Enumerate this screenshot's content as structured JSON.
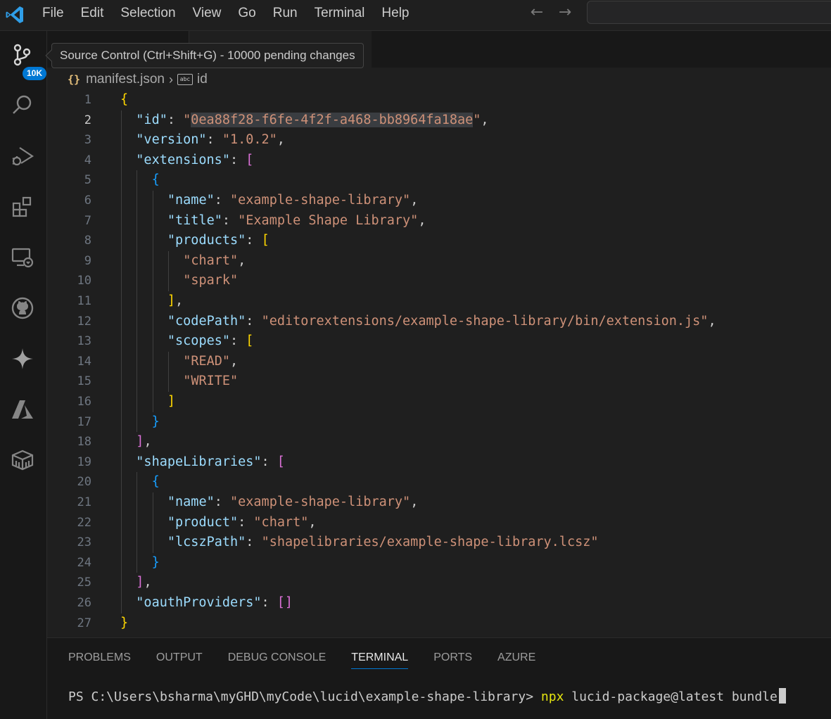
{
  "menu": [
    "File",
    "Edit",
    "Selection",
    "View",
    "Go",
    "Run",
    "Terminal",
    "Help"
  ],
  "activity_bar": {
    "items": [
      "source-control",
      "search",
      "run-debug",
      "extensions",
      "remote-explorer",
      "github",
      "copilot",
      "azure",
      "containers"
    ],
    "badge": "10K",
    "accent": "#0078d4"
  },
  "tooltip": "Source Control (Ctrl+Shift+G) - 10000 pending changes",
  "breadcrumb": {
    "file_icon": "{}",
    "file": "manifest.json",
    "symbol_icon": "abc",
    "symbol": "id"
  },
  "editor": {
    "current_line": 2,
    "lines": [
      {
        "n": "1",
        "indent": 0,
        "tokens": [
          [
            "b1",
            "{"
          ]
        ]
      },
      {
        "n": "2",
        "indent": 1,
        "tokens": [
          [
            "k",
            "\"id\""
          ],
          [
            "p",
            ": "
          ],
          [
            "s",
            "\""
          ],
          [
            "hl",
            "0ea88f28-f6fe-4f2f-a468-bb8964fa18ae"
          ],
          [
            "s",
            "\""
          ],
          [
            "p",
            ","
          ]
        ]
      },
      {
        "n": "3",
        "indent": 1,
        "tokens": [
          [
            "k",
            "\"version\""
          ],
          [
            "p",
            ": "
          ],
          [
            "s",
            "\"1.0.2\""
          ],
          [
            "p",
            ","
          ]
        ]
      },
      {
        "n": "4",
        "indent": 1,
        "tokens": [
          [
            "k",
            "\"extensions\""
          ],
          [
            "p",
            ": "
          ],
          [
            "b2",
            "["
          ]
        ]
      },
      {
        "n": "5",
        "indent": 2,
        "tokens": [
          [
            "b3",
            "{"
          ]
        ]
      },
      {
        "n": "6",
        "indent": 3,
        "tokens": [
          [
            "k",
            "\"name\""
          ],
          [
            "p",
            ": "
          ],
          [
            "s",
            "\"example-shape-library\""
          ],
          [
            "p",
            ","
          ]
        ]
      },
      {
        "n": "7",
        "indent": 3,
        "tokens": [
          [
            "k",
            "\"title\""
          ],
          [
            "p",
            ": "
          ],
          [
            "s",
            "\"Example Shape Library\""
          ],
          [
            "p",
            ","
          ]
        ]
      },
      {
        "n": "8",
        "indent": 3,
        "tokens": [
          [
            "k",
            "\"products\""
          ],
          [
            "p",
            ": "
          ],
          [
            "b1",
            "["
          ]
        ]
      },
      {
        "n": "9",
        "indent": 4,
        "tokens": [
          [
            "s",
            "\"chart\""
          ],
          [
            "p",
            ","
          ]
        ]
      },
      {
        "n": "10",
        "indent": 4,
        "tokens": [
          [
            "s",
            "\"spark\""
          ]
        ]
      },
      {
        "n": "11",
        "indent": 3,
        "tokens": [
          [
            "b1",
            "]"
          ],
          [
            "p",
            ","
          ]
        ]
      },
      {
        "n": "12",
        "indent": 3,
        "tokens": [
          [
            "k",
            "\"codePath\""
          ],
          [
            "p",
            ": "
          ],
          [
            "s",
            "\"editorextensions/example-shape-library/bin/extension.js\""
          ],
          [
            "p",
            ","
          ]
        ]
      },
      {
        "n": "13",
        "indent": 3,
        "tokens": [
          [
            "k",
            "\"scopes\""
          ],
          [
            "p",
            ": "
          ],
          [
            "b1",
            "["
          ]
        ]
      },
      {
        "n": "14",
        "indent": 4,
        "tokens": [
          [
            "s",
            "\"READ\""
          ],
          [
            "p",
            ","
          ]
        ]
      },
      {
        "n": "15",
        "indent": 4,
        "tokens": [
          [
            "s",
            "\"WRITE\""
          ]
        ]
      },
      {
        "n": "16",
        "indent": 3,
        "tokens": [
          [
            "b1",
            "]"
          ]
        ]
      },
      {
        "n": "17",
        "indent": 2,
        "tokens": [
          [
            "b3",
            "}"
          ]
        ]
      },
      {
        "n": "18",
        "indent": 1,
        "tokens": [
          [
            "b2",
            "]"
          ],
          [
            "p",
            ","
          ]
        ]
      },
      {
        "n": "19",
        "indent": 1,
        "tokens": [
          [
            "k",
            "\"shapeLibraries\""
          ],
          [
            "p",
            ": "
          ],
          [
            "b2",
            "["
          ]
        ]
      },
      {
        "n": "20",
        "indent": 2,
        "tokens": [
          [
            "b3",
            "{"
          ]
        ]
      },
      {
        "n": "21",
        "indent": 3,
        "tokens": [
          [
            "k",
            "\"name\""
          ],
          [
            "p",
            ": "
          ],
          [
            "s",
            "\"example-shape-library\""
          ],
          [
            "p",
            ","
          ]
        ]
      },
      {
        "n": "22",
        "indent": 3,
        "tokens": [
          [
            "k",
            "\"product\""
          ],
          [
            "p",
            ": "
          ],
          [
            "s",
            "\"chart\""
          ],
          [
            "p",
            ","
          ]
        ]
      },
      {
        "n": "23",
        "indent": 3,
        "tokens": [
          [
            "k",
            "\"lcszPath\""
          ],
          [
            "p",
            ": "
          ],
          [
            "s",
            "\"shapelibraries/example-shape-library.lcsz\""
          ]
        ]
      },
      {
        "n": "24",
        "indent": 2,
        "tokens": [
          [
            "b3",
            "}"
          ]
        ]
      },
      {
        "n": "25",
        "indent": 1,
        "tokens": [
          [
            "b2",
            "]"
          ],
          [
            "p",
            ","
          ]
        ]
      },
      {
        "n": "26",
        "indent": 1,
        "tokens": [
          [
            "k",
            "\"oauthProviders\""
          ],
          [
            "p",
            ": "
          ],
          [
            "b2",
            "[]"
          ]
        ]
      },
      {
        "n": "27",
        "indent": 0,
        "tokens": [
          [
            "b1",
            "}"
          ]
        ]
      }
    ]
  },
  "panel": {
    "tabs": [
      "PROBLEMS",
      "OUTPUT",
      "DEBUG CONSOLE",
      "TERMINAL",
      "PORTS",
      "AZURE"
    ],
    "active_tab": "TERMINAL",
    "prompt": "PS C:\\Users\\bsharma\\myGHD\\myCode\\lucid\\example-shape-library> ",
    "command": "npx",
    "args": " lucid-package@latest bundle"
  }
}
